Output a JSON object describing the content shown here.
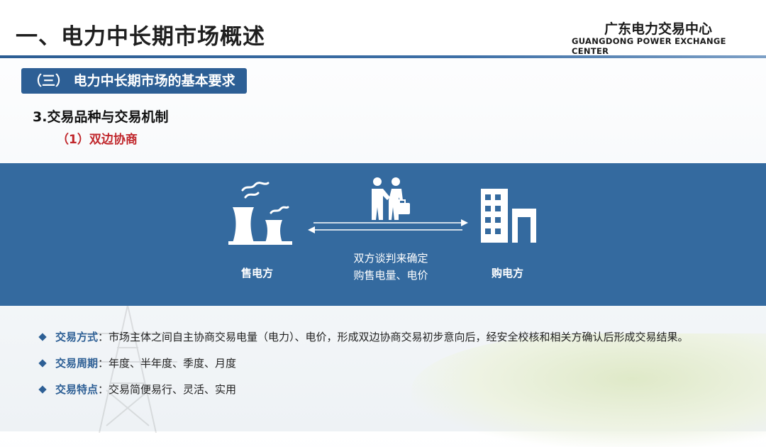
{
  "header": {
    "title": "一、电力中长期市场概述",
    "org_cn": "广东电力交易中心",
    "org_en": "GUANGDONG POWER EXCHANGE CENTER"
  },
  "section": {
    "badge": "（三） 电力中长期市场的基本要求",
    "subheading": "3.交易品种与交易机制",
    "subsubheading": "（1）双边协商"
  },
  "diagram": {
    "seller_label": "售电方",
    "buyer_label": "购电方",
    "center_line1": "双方谈判来确定",
    "center_line2": "购售电量、电价",
    "seller_icon": "power-plant-icon",
    "buyer_icon": "building-icon",
    "deal_icon": "handshake-icon",
    "band_color": "#346a9f"
  },
  "bullets": [
    {
      "term": "交易方式",
      "sep": "：",
      "text": "市场主体之间自主协商交易电量（电力）、电价，形成双边协商交易初步意向后，经安全校核和相关方确认后形成交易结果。"
    },
    {
      "term": "交易周期",
      "sep": "：",
      "text": "年度、半年度、季度、月度"
    },
    {
      "term": "交易特点",
      "sep": "：",
      "text": "交易简便易行、灵活、实用"
    }
  ],
  "colors": {
    "accent": "#2d5f95",
    "highlight": "#c0262b"
  }
}
